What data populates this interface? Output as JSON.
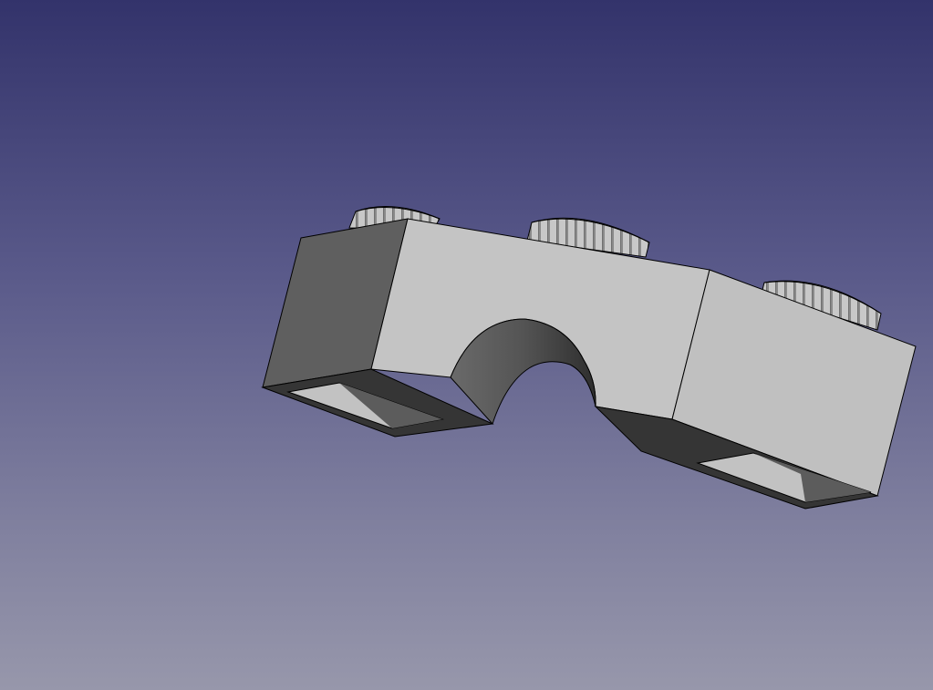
{
  "viewport": {
    "background_top": "#33336b",
    "background_bottom": "#9797ab"
  },
  "model": {
    "part": "arch-brick",
    "body_color": "#c4c4c4",
    "shade_color": "#5f5f5f",
    "dark_color": "#333333",
    "edge_color": "#000000",
    "stud_count": 3
  }
}
